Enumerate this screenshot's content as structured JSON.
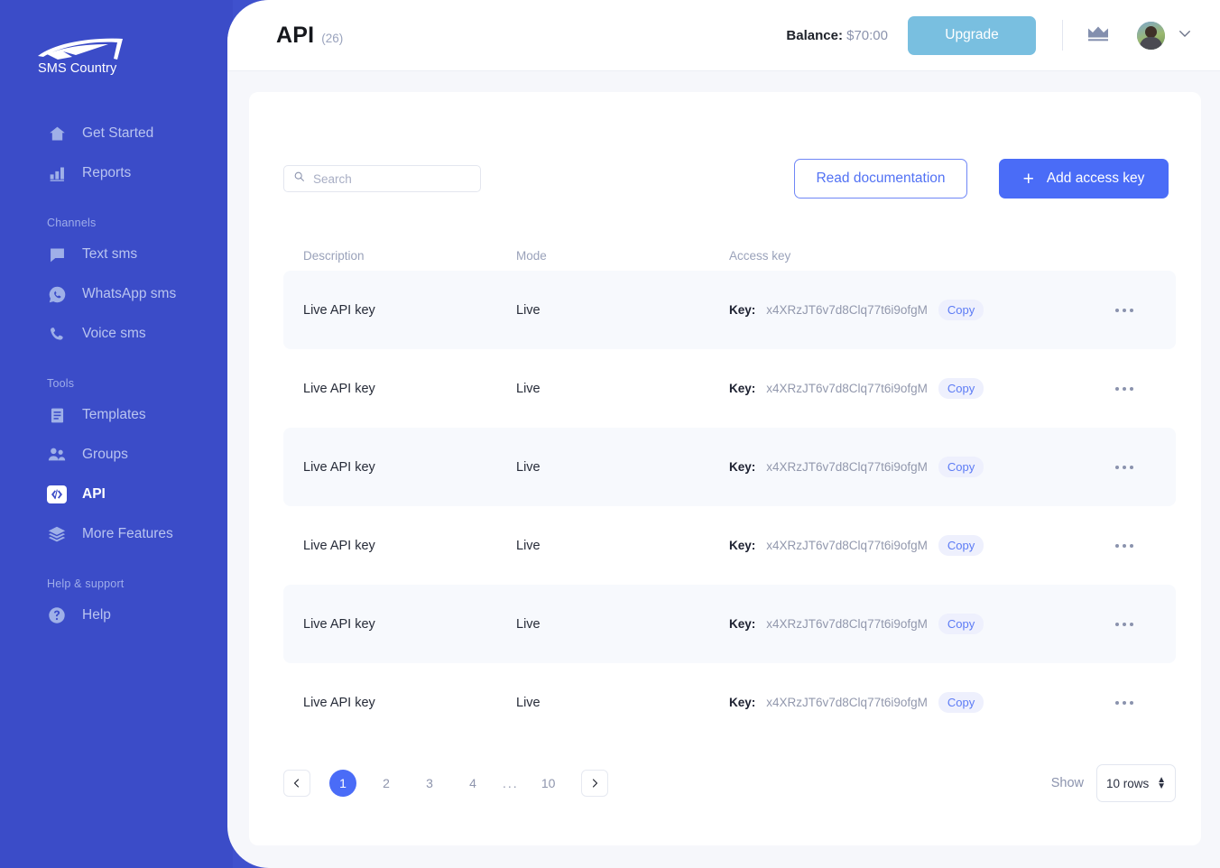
{
  "sidebar": {
    "logo": {
      "text": "SMS Country",
      "icon": "paper-plane-logo"
    },
    "groups": [
      {
        "label": null,
        "items": [
          {
            "label": "Get Started",
            "icon": "home-icon",
            "active": false
          },
          {
            "label": "Reports",
            "icon": "bar-chart-icon",
            "active": false
          }
        ]
      },
      {
        "label": "Channels",
        "items": [
          {
            "label": "Text sms",
            "icon": "chat-bubble-icon",
            "active": false
          },
          {
            "label": "WhatsApp sms",
            "icon": "whatsapp-icon",
            "active": false
          },
          {
            "label": "Voice sms",
            "icon": "phone-icon",
            "active": false
          }
        ]
      },
      {
        "label": "Tools",
        "items": [
          {
            "label": "Templates",
            "icon": "document-icon",
            "active": false
          },
          {
            "label": "Groups",
            "icon": "people-icon",
            "active": false
          },
          {
            "label": "API",
            "icon": "code-brackets-icon",
            "active": true
          },
          {
            "label": "More Features",
            "icon": "layers-icon",
            "active": false
          }
        ]
      },
      {
        "label": "Help & support",
        "items": [
          {
            "label": "Help",
            "icon": "question-circle-icon",
            "active": false
          }
        ]
      }
    ]
  },
  "topbar": {
    "title": "API",
    "count": "(26)",
    "balance_label": "Balance:",
    "balance_value": "$70:00",
    "upgrade_label": "Upgrade",
    "crown_icon": "crown-icon",
    "avatar_icon": "user-avatar",
    "caret_icon": "chevron-down-icon"
  },
  "toolbar": {
    "search_placeholder": "Search",
    "search_value": "",
    "search_icon": "search-icon",
    "read_docs_label": "Read documentation",
    "add_key_label": "Add access key",
    "add_key_icon": "plus-icon"
  },
  "table": {
    "columns": [
      "Description",
      "Mode",
      "Access key"
    ],
    "key_prefix": "Key:",
    "copy_label": "Copy",
    "menu_icon": "ellipsis-icon",
    "rows": [
      {
        "description": "Live API key",
        "mode": "Live",
        "key": "x4XRzJT6v7d8Clq77t6i9ofgM"
      },
      {
        "description": "Live API key",
        "mode": "Live",
        "key": "x4XRzJT6v7d8Clq77t6i9ofgM"
      },
      {
        "description": "Live API key",
        "mode": "Live",
        "key": "x4XRzJT6v7d8Clq77t6i9ofgM"
      },
      {
        "description": "Live API key",
        "mode": "Live",
        "key": "x4XRzJT6v7d8Clq77t6i9ofgM"
      },
      {
        "description": "Live API key",
        "mode": "Live",
        "key": "x4XRzJT6v7d8Clq77t6i9ofgM"
      },
      {
        "description": "Live API key",
        "mode": "Live",
        "key": "x4XRzJT6v7d8Clq77t6i9ofgM"
      }
    ]
  },
  "pagination": {
    "prev_icon": "chevron-left-icon",
    "next_icon": "chevron-right-icon",
    "pages": [
      "1",
      "2",
      "3",
      "4",
      "...",
      "10"
    ],
    "current": "1",
    "show_label": "Show",
    "rows_value": "10 rows",
    "stepper_icon": "up-down-stepper-icon"
  },
  "colors": {
    "sidebar_bg": "#3b4cc8",
    "primary": "#4a6cf7",
    "upgrade": "#79bfe0",
    "page_bg": "#f6f7fb",
    "row_alt": "#f7f9fd",
    "copy_badge_bg": "#eef0fd"
  }
}
